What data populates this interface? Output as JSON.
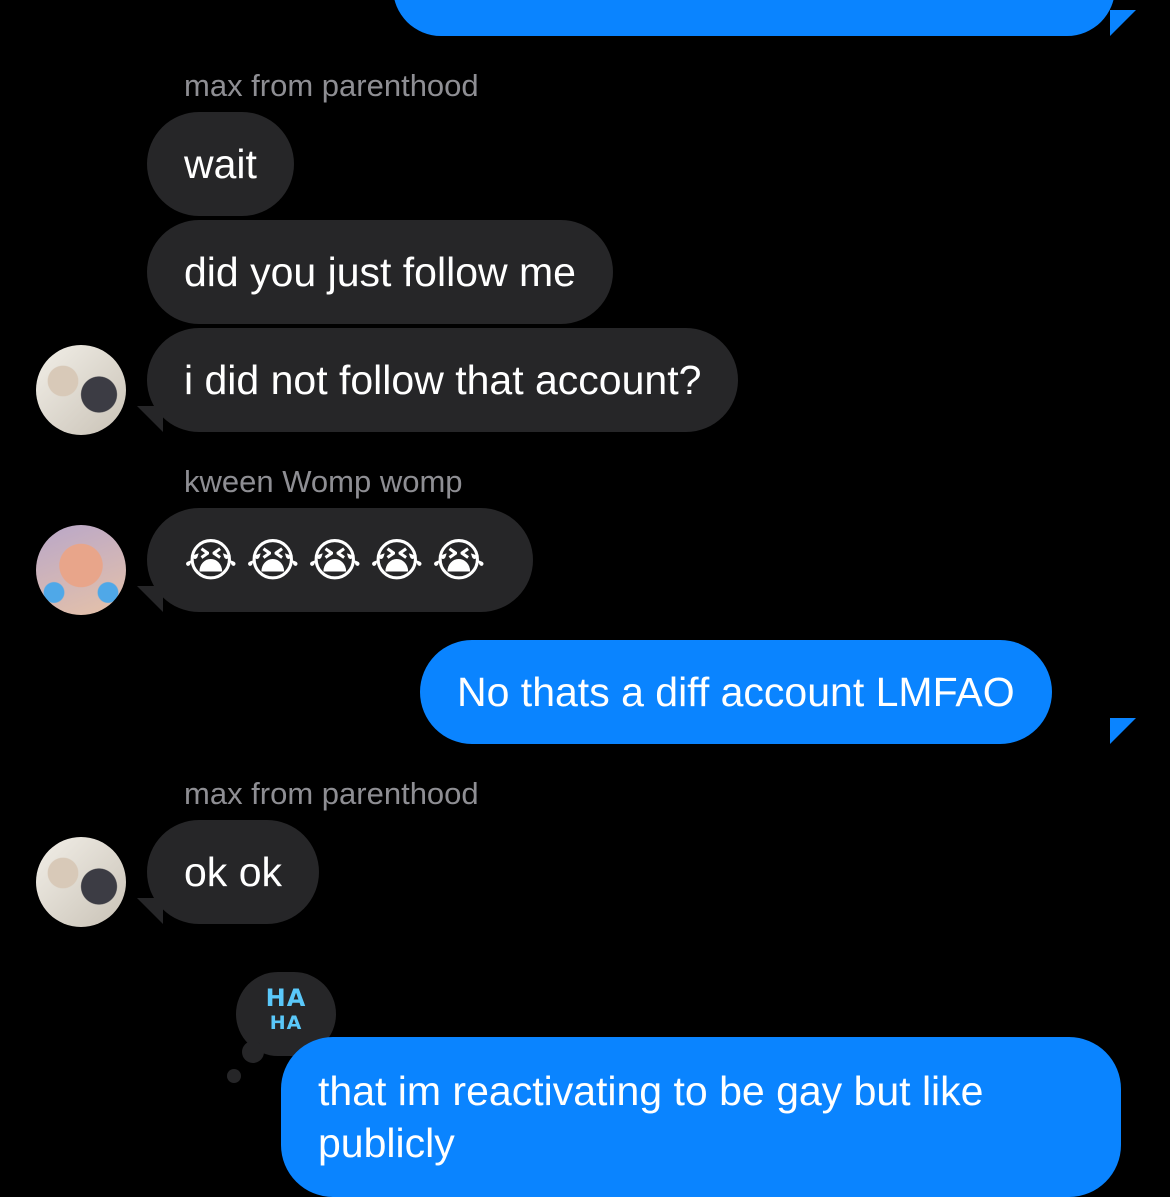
{
  "conversation": {
    "messages": [
      {
        "sender": "max from parenthood",
        "text": "wait"
      },
      {
        "text": "did you just follow me"
      },
      {
        "text": "i did not follow that account?"
      },
      {
        "sender": "kween Womp womp",
        "text": "😭😭😭😭😭"
      },
      {
        "text": "No thats a diff account LMFAO"
      },
      {
        "sender": "max from parenthood",
        "text": "ok ok"
      },
      {
        "text": "that im reactivating to be gay but like publicly"
      }
    ],
    "emojis": [
      "😭",
      "😭",
      "😭",
      "😭",
      "😭"
    ],
    "tapback": {
      "line1": "HA",
      "line2": "HA",
      "icon": "haha-tapback-icon"
    }
  },
  "colors": {
    "background": "#000000",
    "incoming_bubble": "#262628",
    "outgoing_bubble": "#0a84ff",
    "sender_label": "#8e8e93"
  }
}
